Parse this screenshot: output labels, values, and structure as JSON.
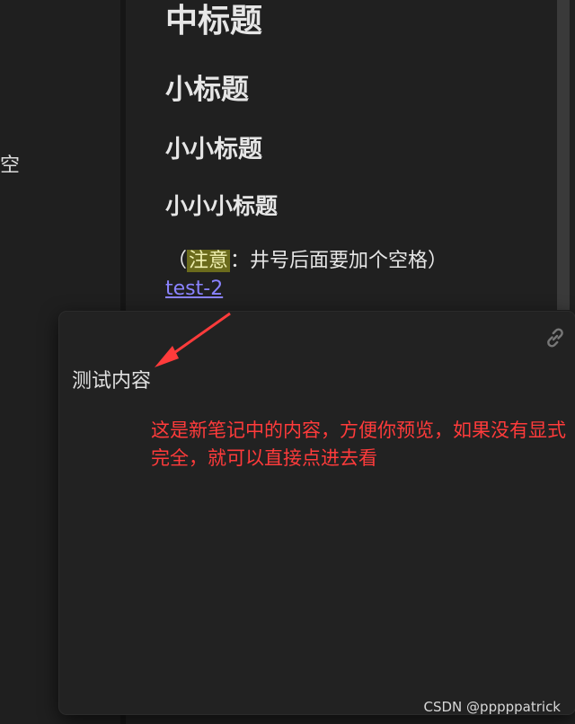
{
  "sidebar": {
    "clipped_text": "空"
  },
  "document": {
    "heading_2": "中标题",
    "heading_3": "小标题",
    "heading_4": "小小标题",
    "heading_5": "小小小标题",
    "note": {
      "open_paren": "（",
      "highlight": "注意",
      "rest": "：井号后面要加个空格）"
    },
    "link_text": "test-2"
  },
  "preview_popover": {
    "body_text": "测试内容",
    "open_link_icon": "link-icon"
  },
  "annotation": {
    "text": "这是新笔记中的内容，方便你预览，如果没有显式完全，就可以直接点进去看",
    "color": "#ff3b3b"
  },
  "watermark": "CSDN @pppppatrick",
  "colors": {
    "background": "#1e1e1e",
    "link": "#8a83ff",
    "highlight_bg": "#6b6b1c"
  }
}
